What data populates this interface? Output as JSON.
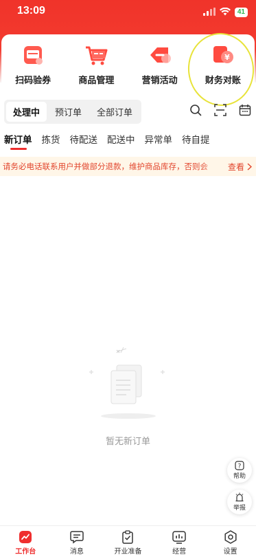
{
  "status_bar": {
    "time": "13:09",
    "battery": "41"
  },
  "quick_actions": [
    {
      "label": "扫码验券",
      "icon": "ticket-scan-icon"
    },
    {
      "label": "商品管理",
      "icon": "cart-icon"
    },
    {
      "label": "营销活动",
      "icon": "tag-icon"
    },
    {
      "label": "财务对账",
      "icon": "yuan-finance-icon"
    }
  ],
  "segments": [
    "处理中",
    "预订单",
    "全部订单"
  ],
  "status_tabs": [
    "新订单",
    "拣货",
    "待配送",
    "配送中",
    "异常单",
    "待自提"
  ],
  "notice": {
    "text": "请务必电话联系用户并做部分退款，维护商品库存，否则会",
    "link": "查看"
  },
  "empty_state": {
    "text": "暂无新订单"
  },
  "floating": {
    "help": "帮助",
    "report": "举报"
  },
  "bottom_nav": [
    {
      "label": "工作台",
      "icon": "workbench-icon",
      "active": true
    },
    {
      "label": "消息",
      "icon": "message-icon",
      "active": false
    },
    {
      "label": "开业准备",
      "icon": "clipboard-icon",
      "active": false
    },
    {
      "label": "经营",
      "icon": "chart-icon",
      "active": false
    },
    {
      "label": "设置",
      "icon": "settings-icon",
      "active": false
    }
  ],
  "colors": {
    "brand_red": "#ef2e2e",
    "notice_bg": "#fff6e8",
    "notice_text": "#e2452d",
    "highlight": "#e8e33a"
  }
}
